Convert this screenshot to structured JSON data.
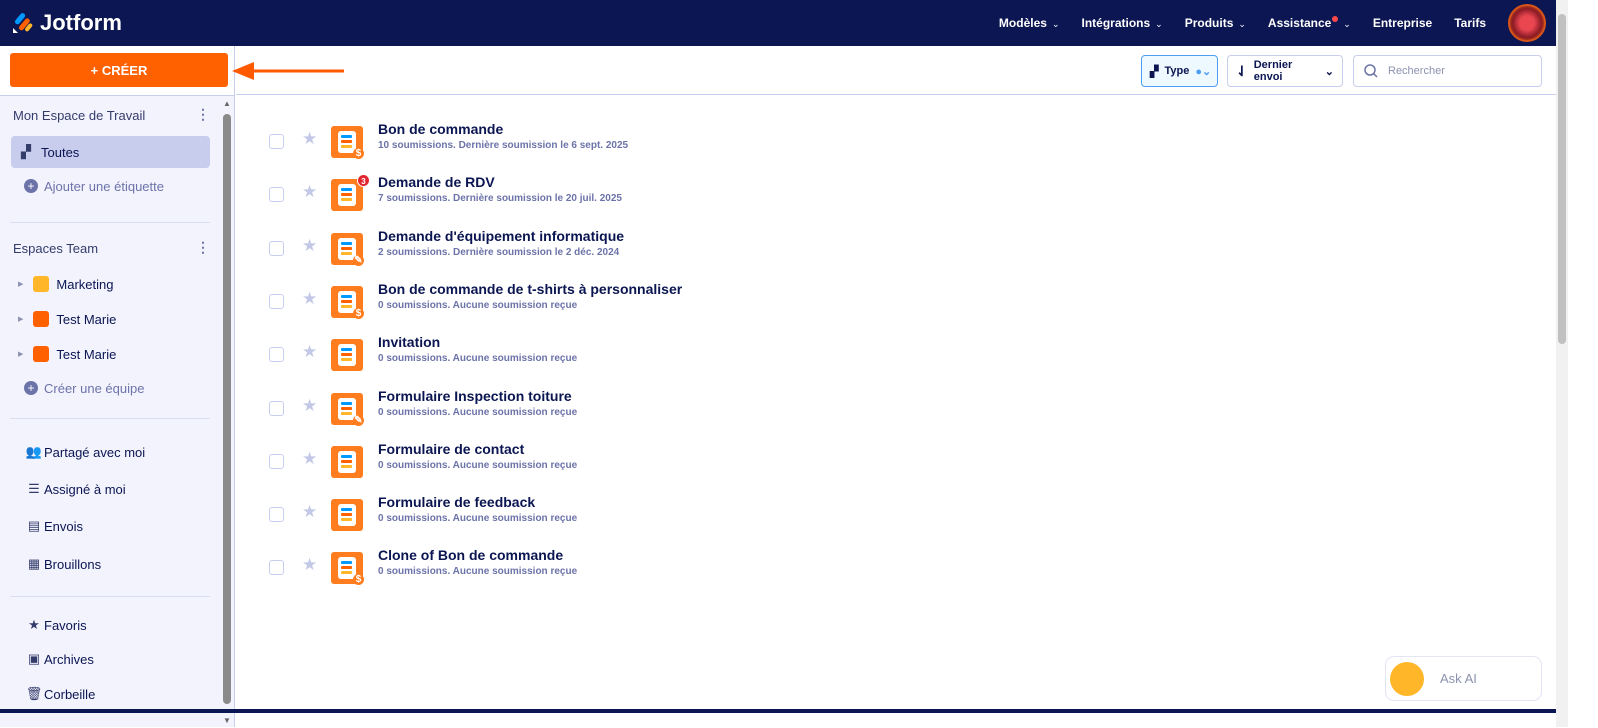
{
  "header": {
    "brand": "Jotform",
    "nav": [
      {
        "label": "Modèles"
      },
      {
        "label": "Intégrations"
      },
      {
        "label": "Produits"
      },
      {
        "label": "Assistance"
      },
      {
        "label": "Entreprise"
      },
      {
        "label": "Tarifs"
      }
    ]
  },
  "sidebar": {
    "create_label": "+ CRÉER",
    "workspace_title": "Mon Espace de Travail",
    "all_label": "Toutes",
    "add_label": "Ajouter une étiquette",
    "teams_title": "Espaces Team",
    "teams": [
      {
        "name": "Marketing",
        "color": "#ffb629"
      },
      {
        "name": "Test Marie",
        "color": "#ff6100"
      },
      {
        "name": "Test Marie",
        "color": "#ff6100"
      }
    ],
    "create_team": "Créer une équipe",
    "links": [
      {
        "label": "Partagé avec moi",
        "icon": "shared-icon"
      },
      {
        "label": "Assigné à moi",
        "icon": "assigned-icon"
      },
      {
        "label": "Envois",
        "icon": "submissions-icon"
      },
      {
        "label": "Brouillons",
        "icon": "drafts-icon"
      }
    ],
    "links2": [
      {
        "label": "Favoris",
        "icon": "star-icon"
      },
      {
        "label": "Archives",
        "icon": "archive-icon"
      },
      {
        "label": "Corbeille",
        "icon": "trash-icon"
      }
    ]
  },
  "toolbar": {
    "type_label": "Type",
    "sort_label": "Dernier envoi",
    "search_placeholder": "Rechercher"
  },
  "forms": [
    {
      "title": "Bon de commande",
      "sub": "10 soumissions. Dernière soumission le 6 sept. 2025",
      "icon": "payment"
    },
    {
      "title": "Demande de RDV",
      "sub": "7 soumissions. Dernière soumission le 20 juil. 2025",
      "icon": "plain",
      "badge": "3"
    },
    {
      "title": "Demande d'équipement informatique",
      "sub": "2 soumissions. Dernière soumission le 2 déc. 2024",
      "icon": "sign"
    },
    {
      "title": "Bon de commande de t-shirts à personnaliser",
      "sub": "0 soumissions. Aucune soumission reçue",
      "icon": "payment"
    },
    {
      "title": "Invitation",
      "sub": "0 soumissions. Aucune soumission reçue",
      "icon": "plain"
    },
    {
      "title": "Formulaire Inspection toiture",
      "sub": "0 soumissions. Aucune soumission reçue",
      "icon": "sign"
    },
    {
      "title": "Formulaire de contact",
      "sub": "0 soumissions. Aucune soumission reçue",
      "icon": "plain"
    },
    {
      "title": "Formulaire de feedback",
      "sub": "0 soumissions. Aucune soumission reçue",
      "icon": "plain"
    },
    {
      "title": "Clone of Bon de commande",
      "sub": "0 soumissions. Aucune soumission reçue",
      "icon": "payment"
    }
  ],
  "ask_ai": "Ask AI",
  "colors": {
    "navy": "#0c1652",
    "orange": "#ff6100",
    "accent": "#4c9ff4"
  }
}
